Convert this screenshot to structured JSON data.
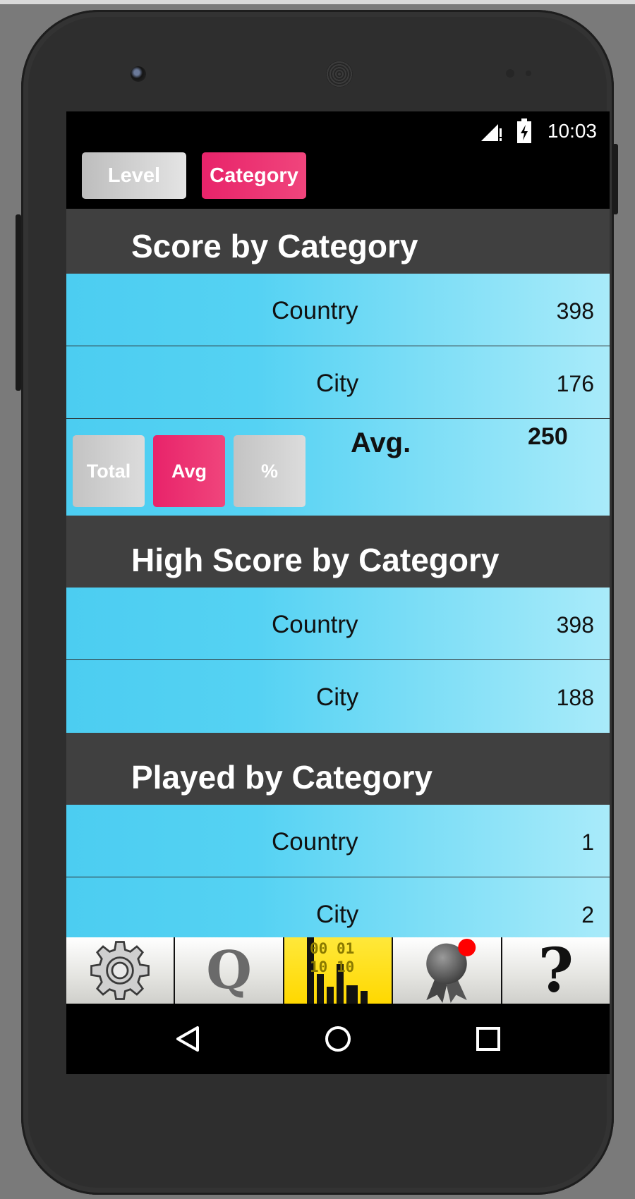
{
  "status_bar": {
    "time": "10:03"
  },
  "tabs": [
    {
      "label": "Level",
      "selected": false
    },
    {
      "label": "Category",
      "selected": true
    }
  ],
  "score_section": {
    "title": "Score by Category",
    "rows": [
      {
        "category": "Country",
        "value": "398"
      },
      {
        "category": "City",
        "value": "176"
      }
    ],
    "controls": {
      "total_label": "Total",
      "avg_label": "Avg",
      "percent_label": "%",
      "selected": "Avg"
    },
    "summary_label": "Avg.",
    "summary_value": "250"
  },
  "high_score_section": {
    "title": "High Score by Category",
    "rows": [
      {
        "category": "Country",
        "value": "398"
      },
      {
        "category": "City",
        "value": "188"
      }
    ]
  },
  "played_section": {
    "title": "Played by Category",
    "rows": [
      {
        "category": "Country",
        "value": "1"
      },
      {
        "category": "City",
        "value": "2"
      }
    ]
  },
  "bottom_nav": {
    "items": [
      {
        "icon": "gear-icon"
      },
      {
        "icon": "quiz-q-icon",
        "glyph": "Q"
      },
      {
        "icon": "stats-binary-icon",
        "active": true,
        "binary_top": "00 01",
        "binary_bottom": "10 10"
      },
      {
        "icon": "award-ribbon-icon",
        "notification": true
      },
      {
        "icon": "help-question-icon",
        "glyph": "?"
      }
    ]
  },
  "colors": {
    "accent": "#E8236A",
    "section_header": "#404040",
    "row_gradient_start": "#4CCDF1",
    "row_gradient_end": "#A9EBFA",
    "nav_active": "#FFE000",
    "notification_dot": "#FF0000"
  }
}
